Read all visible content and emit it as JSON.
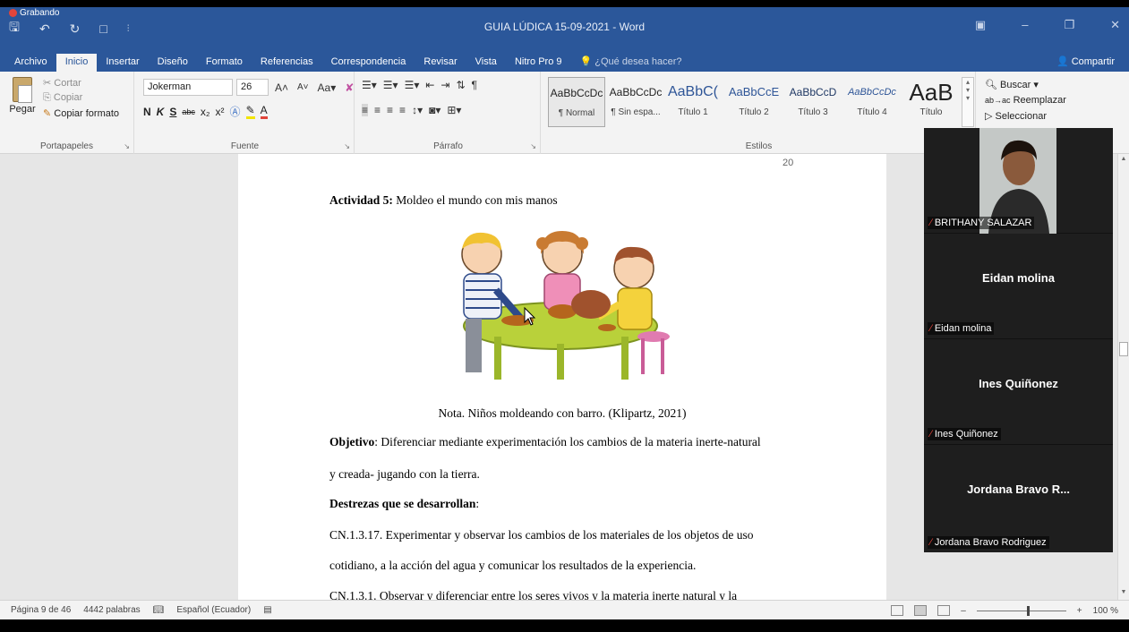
{
  "recording": {
    "label": "Grabando"
  },
  "window": {
    "title": "GUIA LÚDICA 15-09-2021 - Word"
  },
  "tabs": [
    {
      "label": "Archivo"
    },
    {
      "label": "Inicio"
    },
    {
      "label": "Insertar"
    },
    {
      "label": "Diseño"
    },
    {
      "label": "Formato"
    },
    {
      "label": "Referencias"
    },
    {
      "label": "Correspondencia"
    },
    {
      "label": "Revisar"
    },
    {
      "label": "Vista"
    },
    {
      "label": "Nitro Pro 9"
    },
    {
      "label": "¿Qué desea hacer?"
    }
  ],
  "share_label": "Compartir",
  "clipboard": {
    "paste": "Pegar",
    "cut": "Cortar",
    "copy": "Copiar",
    "format_painter": "Copiar formato",
    "group": "Portapapeles"
  },
  "font": {
    "name": "Jokerman",
    "size": "26",
    "group": "Fuente",
    "bold": "N",
    "italic": "K",
    "underline": "S"
  },
  "paragraph": {
    "group": "Párrafo"
  },
  "styles": {
    "group": "Estilos",
    "items": [
      {
        "sample": "AaBbCcDc",
        "name": "¶ Normal"
      },
      {
        "sample": "AaBbCcDc",
        "name": "¶ Sin espa..."
      },
      {
        "sample": "AaBbC(",
        "name": "Título 1"
      },
      {
        "sample": "AaBbCcE",
        "name": "Título 2"
      },
      {
        "sample": "AaBbCcD",
        "name": "Título 3"
      },
      {
        "sample": "AaBbCcDc",
        "name": "Título 4"
      },
      {
        "sample": "AaB",
        "name": "Título"
      }
    ]
  },
  "editing": {
    "find": "Buscar",
    "replace": "Reemplazar",
    "select": "Seleccionar"
  },
  "document": {
    "page_number": "20",
    "activity_bold": "Actividad 5:",
    "activity_text": " Moldeo el mundo con mis manos",
    "caption": "Nota. Niños moldeando con barro. (Klipartz, 2021)",
    "objective_bold": "Objetivo",
    "objective_text": ": Diferenciar mediante experimentación los cambios de la materia inerte-natural",
    "objective_cont": "y creada- jugando con la tierra.",
    "skills_bold": "Destrezas que se desarrollan",
    "skills_colon": ":",
    "skill1": "CN.1.3.17. Experimentar y observar los cambios de los materiales de los objetos de uso",
    "skill1_cont": "cotidiano, a la acción del agua y comunicar los resultados de la experiencia.",
    "skill2": "CN.1.3.1. Observar y diferenciar entre los seres vivos y la materia inerte natural y la"
  },
  "status": {
    "page": "Página 9 de 46",
    "words": "4442 palabras",
    "language": "Español (Ecuador)",
    "zoom": "100 %"
  },
  "participants": [
    {
      "name": "BRITHANY SALAZAR",
      "tag": "BRITHANY SALAZAR",
      "has_video": true
    },
    {
      "name": "Eidan molina",
      "tag": "Eidan molina",
      "has_video": false
    },
    {
      "name": "Ines Quiñonez",
      "tag": "Ines Quiñonez",
      "has_video": false
    },
    {
      "name": "Jordana Bravo R...",
      "tag": "Jordana Bravo Rodriguez",
      "has_video": false
    }
  ],
  "colors": {
    "word_blue": "#2b579a",
    "mic_off": "#e0443a",
    "panel_bg": "#1e1e1e"
  }
}
